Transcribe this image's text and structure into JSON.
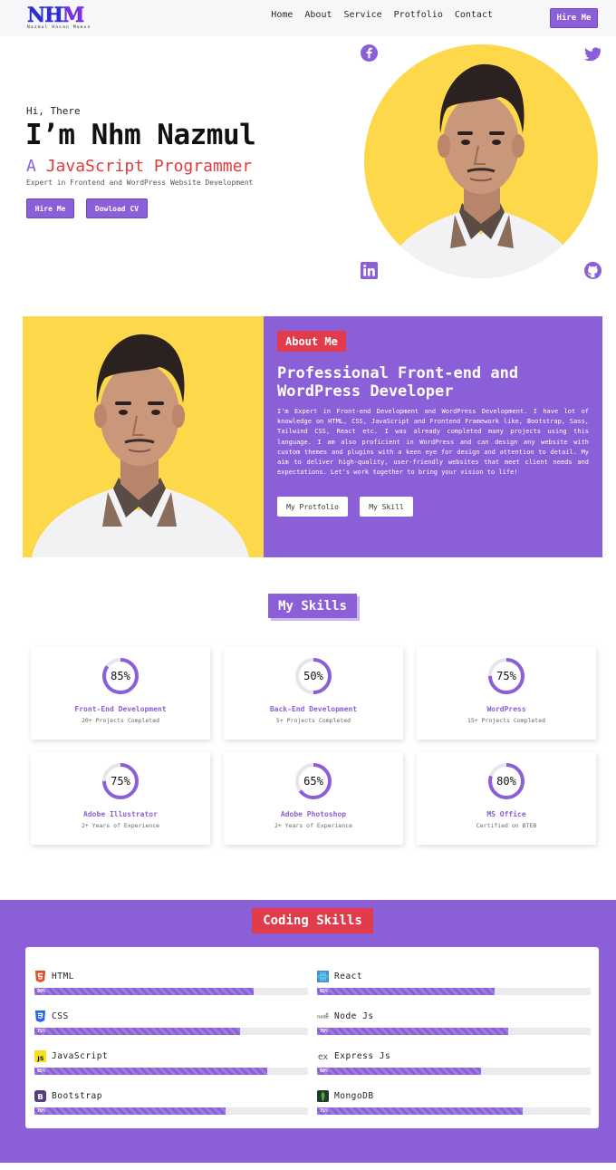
{
  "logo": {
    "text": "NHM",
    "subtitle": "Nazmul Hasan Mamun"
  },
  "nav": {
    "links": [
      "Home",
      "About",
      "Service",
      "Protfolio",
      "Contact"
    ],
    "hire_label": "Hire Me"
  },
  "hero": {
    "greeting": "Hi, There",
    "name": "I’m Nhm Nazmul",
    "role_article": "A",
    "role_title": "JavaScript Programmer",
    "tagline": "Expert in Frontend and WordPress Website Development",
    "hire_label": "Hire Me",
    "cv_label": "Dowload CV",
    "socials": [
      "facebook-icon",
      "twitter-icon",
      "linkedin-icon",
      "github-icon"
    ]
  },
  "about": {
    "badge": "About Me",
    "title": "Professional Front-end and WordPress Developer",
    "description": "I'm Expert in Front-end Development and WordPress Development. I have lot of knowledge on HTML, CSS, JavaScript and Frontend Framework like, Bootstrap, Sass, Tailwind CSS, React etc. I was already completed many projects using this language. I am also proficient in WordPress and can design any website with custom themes and plugins with a keen eye for design and attention to detail. My aim to deliver high-quality, user-friendly websites that meet client needs and expectations. Let's work together to bring your vision to life!",
    "portfolio_label": "My Protfolio",
    "skill_label": "My Skill"
  },
  "skills": {
    "title": "My Skills",
    "cards": [
      {
        "percent": 85,
        "label": "85%",
        "title": "Front-End Development",
        "sub": "20+ Projects Completed"
      },
      {
        "percent": 50,
        "label": "50%",
        "title": "Back-End Development",
        "sub": "5+ Projects Completed"
      },
      {
        "percent": 75,
        "label": "75%",
        "title": "WordPress",
        "sub": "15+ Projects Completed"
      },
      {
        "percent": 75,
        "label": "75%",
        "title": "Adobe Illustrator",
        "sub": "2+ Years of Experience"
      },
      {
        "percent": 65,
        "label": "65%",
        "title": "Adobe Photoshop",
        "sub": "2+ Years of Experience"
      },
      {
        "percent": 80,
        "label": "80%",
        "title": "MS Office",
        "sub": "Certified on BTEB"
      }
    ]
  },
  "coding": {
    "title": "Coding Skills",
    "bars": [
      {
        "name": "HTML",
        "percent": 80,
        "label": "80%",
        "icon": "html5-icon",
        "color": "#e44d26"
      },
      {
        "name": "React",
        "percent": 65,
        "label": "65%",
        "icon": "react-icon",
        "color": "#61dafb"
      },
      {
        "name": "CSS",
        "percent": 75,
        "label": "75%",
        "icon": "css3-icon",
        "color": "#2965f1"
      },
      {
        "name": "Node Js",
        "percent": 70,
        "label": "70%",
        "icon": "nodejs-icon",
        "color": "#539e43"
      },
      {
        "name": "JavaScript",
        "percent": 85,
        "label": "85%",
        "icon": "javascript-icon",
        "color": "#f7df1e"
      },
      {
        "name": "Express Js",
        "percent": 60,
        "label": "60%",
        "icon": "express-icon",
        "color": "#555555"
      },
      {
        "name": "Bootstrap",
        "percent": 70,
        "label": "70%",
        "icon": "bootstrap-icon",
        "color": "#563d7c"
      },
      {
        "name": "MongoDB",
        "percent": 75,
        "label": "75%",
        "icon": "mongodb-icon",
        "color": "#4faa41"
      }
    ]
  },
  "colors": {
    "accent": "#8a5fd8",
    "red": "#e23b4b",
    "yellow": "#fcd84a"
  }
}
